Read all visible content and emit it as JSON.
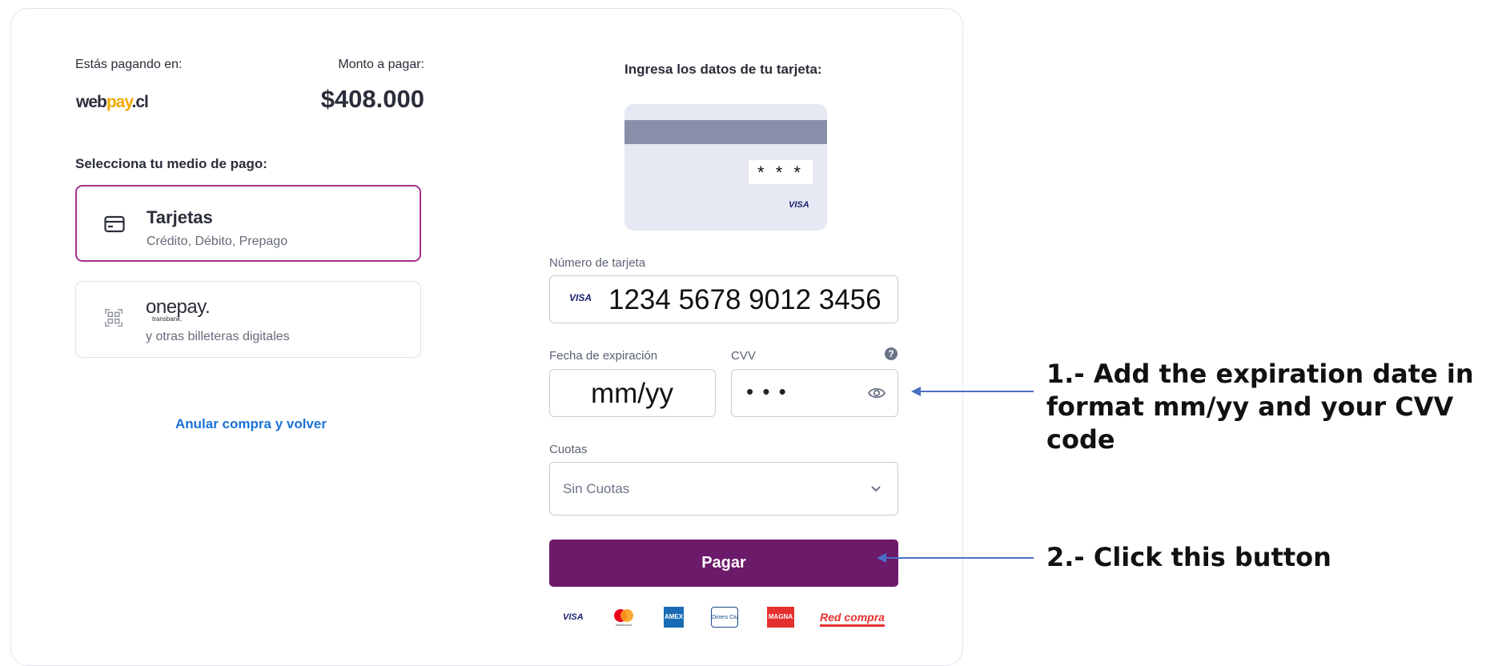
{
  "left": {
    "paying_at_label": "Estás pagando en:",
    "amount_label": "Monto a pagar:",
    "logo": {
      "web": "web",
      "pay": "pay",
      "cl": ".cl"
    },
    "amount": "$408.000",
    "select_label": "Selecciona tu medio de pago:",
    "methods": [
      {
        "title": "Tarjetas",
        "subtitle": "Crédito, Débito, Prepago",
        "icon": "credit-card-icon",
        "selected": true
      },
      {
        "title": "onepay.",
        "brand_sub": "transbank.",
        "subtitle": "y otras billeteras digitales",
        "icon": "qr-code-icon",
        "selected": false
      }
    ],
    "cancel_link": "Anular compra y volver"
  },
  "form": {
    "title": "Ingresa los datos de tu tarjeta:",
    "card_preview": {
      "cvv_mask": "* * *",
      "brand": "VISA"
    },
    "card_number_label": "Número de tarjeta",
    "card_brand": "VISA",
    "card_number": "1234 5678 9012 3456",
    "expiry_label": "Fecha de expiración",
    "expiry_placeholder": "mm/yy",
    "cvv_label": "CVV",
    "cvv_help": "?",
    "cvv_mask": "• • •",
    "installments_label": "Cuotas",
    "installments_value": "Sin Cuotas",
    "pay_button": "Pagar",
    "brands": [
      "VISA",
      "mastercard",
      "AMEX",
      "Diners Club",
      "MAGNA",
      "Red compra"
    ]
  },
  "annotations": {
    "step1_line1": "1.- Add the expiration date in",
    "step1_line2": "format mm/yy and your CVV code",
    "step2": "2.- Click this button"
  },
  "colors": {
    "accent": "#6c1a6a",
    "selected_border": "#a5318f",
    "link": "#1b72d8",
    "arrow": "#4a6fc4"
  }
}
